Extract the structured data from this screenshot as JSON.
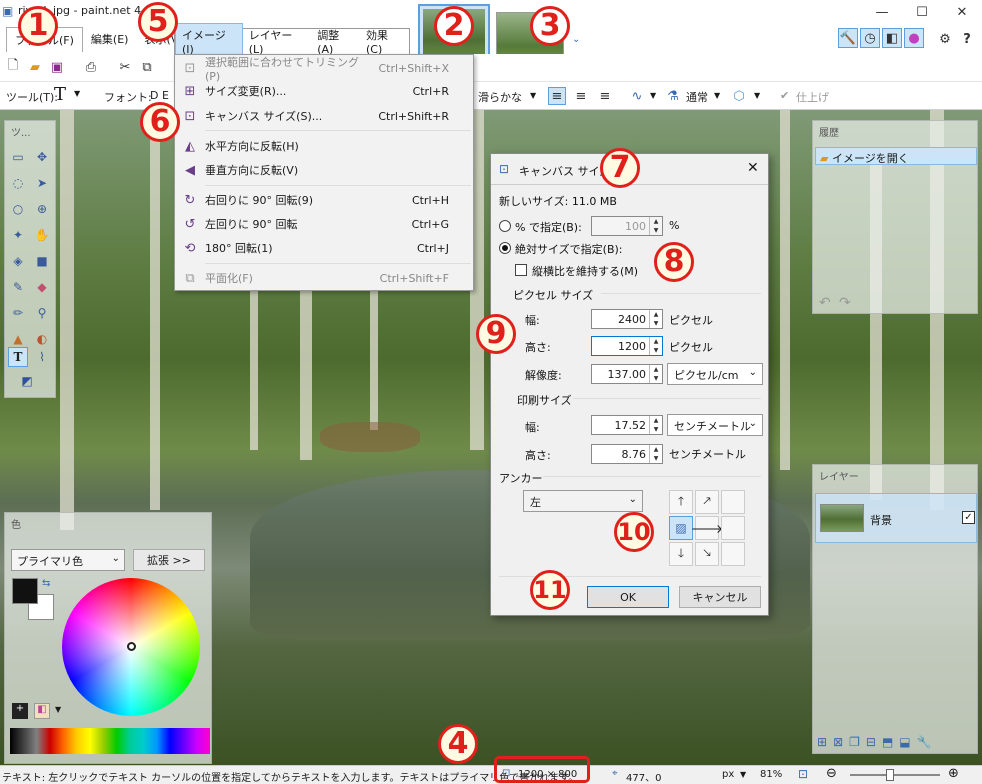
{
  "window": {
    "title": "riverL.jpg - paint.net 4.10",
    "minimize": "—",
    "maximize": "☐",
    "close": "✕"
  },
  "menu": {
    "file": "ファイル(F)",
    "edit": "編集(E)",
    "view": "表示(V)",
    "image": "イメージ(I)",
    "layers": "レイヤー(L)",
    "adjust": "調整(A)",
    "effects": "効果(C)"
  },
  "toolbar": {
    "tool_label": "ツール(T):",
    "font_label": "フォント:",
    "font_value": "D E",
    "smooth": "滑らかな",
    "blend_mode": "通常",
    "finish": "仕上げ"
  },
  "image_menu": {
    "items": [
      {
        "label": "選択範囲に合わせてトリミング(P)",
        "shortcut": "Ctrl+Shift+X",
        "disabled": true
      },
      {
        "label": "サイズ変更(R)...",
        "shortcut": "Ctrl+R",
        "disabled": false
      },
      {
        "label": "キャンバス サイズ(S)...",
        "shortcut": "Ctrl+Shift+R",
        "disabled": false
      },
      {
        "label": "水平方向に反転(H)",
        "shortcut": "",
        "disabled": false
      },
      {
        "label": "垂直方向に反転(V)",
        "shortcut": "",
        "disabled": false
      },
      {
        "label": "右回りに 90° 回転(9)",
        "shortcut": "Ctrl+H",
        "disabled": false
      },
      {
        "label": "左回りに 90° 回転",
        "shortcut": "Ctrl+G",
        "disabled": false
      },
      {
        "label": "180° 回転(1)",
        "shortcut": "Ctrl+J",
        "disabled": false
      },
      {
        "label": "平面化(F)",
        "shortcut": "Ctrl+Shift+F",
        "disabled": true
      }
    ]
  },
  "canvas_dialog": {
    "title": "キャンバス サイズ",
    "new_size": "新しいサイズ: 11.0 MB",
    "by_percent": "% で指定(B):",
    "percent_value": "100",
    "percent_unit": "%",
    "by_absolute": "絶対サイズで指定(B):",
    "keep_ratio": "縦横比を維持する(M)",
    "pixel_size": "ピクセル サイズ",
    "width_label": "幅:",
    "width_value": "2400",
    "pixel_unit": "ピクセル",
    "height_label": "高さ:",
    "height_value": "1200",
    "resolution_label": "解像度:",
    "resolution_value": "137.00",
    "resolution_unit": "ピクセル/cm",
    "print_size": "印刷サイズ",
    "print_width_label": "幅:",
    "print_width_value": "17.52",
    "print_width_unit": "センチメートル",
    "print_height_label": "高さ:",
    "print_height_value": "8.76",
    "print_height_unit": "センチメートル",
    "anchor_label": "アンカー",
    "anchor_value": "左",
    "ok": "OK",
    "cancel": "キャンセル"
  },
  "history_panel": {
    "title": "履歴",
    "item": "イメージを開く"
  },
  "layers_panel": {
    "title": "レイヤー",
    "layer_name": "背景"
  },
  "colors_panel": {
    "title": "色",
    "mode": "プライマリ色",
    "expand": "拡張 >>"
  },
  "tools_panel": {
    "title": "ツ..."
  },
  "status": {
    "hint": "テキスト: 左クリックでテキスト カーソルの位置を指定してからテキストを入力します。テキストはプライマリ色で書かれます。",
    "image_size": "1200 × 800",
    "cursor_pos": "477、0",
    "unit": "px",
    "zoom": "81%"
  },
  "annotations": {
    "n1": "1",
    "n2": "2",
    "n3": "3",
    "n4": "4",
    "n5": "5",
    "n6": "6",
    "n7": "7",
    "n8": "8",
    "n9": "9",
    "n10": "10",
    "n11": "11"
  },
  "colors": {
    "annotation_red": "#e0201a",
    "selection_blue": "#cce4f7",
    "accent_blue": "#0078d7"
  }
}
